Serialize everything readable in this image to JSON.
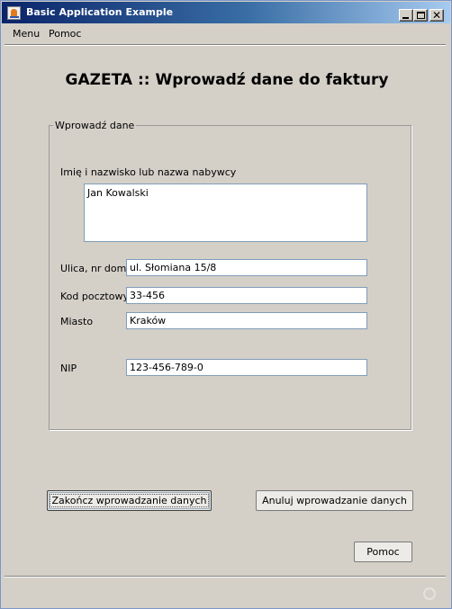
{
  "window": {
    "title": "Basic Application Example"
  },
  "menubar": {
    "items": [
      "Menu",
      "Pomoc"
    ]
  },
  "heading": "GAZETA :: Wprowadź dane do faktury",
  "form": {
    "legend": "Wprowadź dane",
    "buyer_label": "Imię i nazwisko lub nazwa nabywcy",
    "buyer_value": "Jan Kowalski",
    "street_label": "Ulica, nr domu",
    "street_value": "ul. Słomiana 15/8",
    "postal_label": "Kod pocztowy",
    "postal_value": "33-456",
    "city_label": "Miasto",
    "city_value": "Kraków",
    "nip_label": "NIP",
    "nip_value": "123-456-789-0"
  },
  "buttons": {
    "finish": "Zakończ wprowadzanie danych",
    "cancel": "Anuluj wprowadzanie danych",
    "help": "Pomoc"
  }
}
